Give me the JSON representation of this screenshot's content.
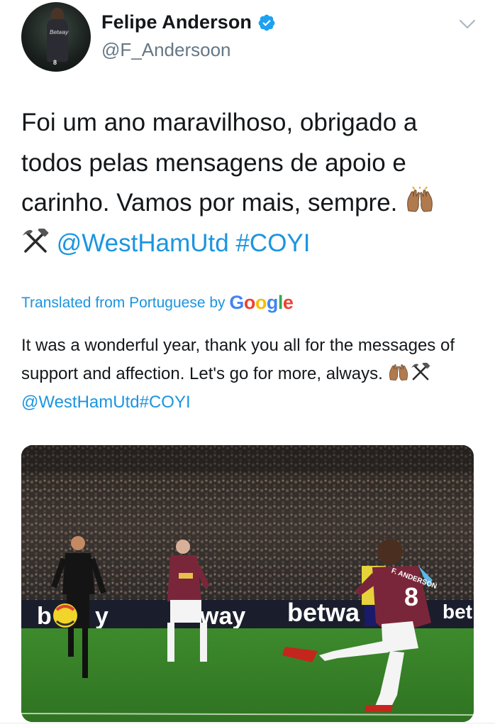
{
  "profile": {
    "display_name": "Felipe Anderson",
    "handle": "@F_Andersoon",
    "verified": true,
    "avatar_icon": "profile-photo",
    "avatar_shirt_text": "Betway",
    "avatar_number": "8"
  },
  "tweet": {
    "line1": "Foi um ano maravilhoso, obrigado a",
    "line2": "todos pelas mensagens de apoio e",
    "line3": "carinho. Vamos por mais, sempre.",
    "mention": "@WestHamUtd",
    "hashtag": "#COYI"
  },
  "translation": {
    "label": "Translated from Portuguese by",
    "provider": [
      "G",
      "o",
      "o",
      "g",
      "l",
      "e"
    ],
    "text_part1": "It was a wonderful year, thank you all for the messages of support and affection. Let's go for more, always.",
    "mention": "@WestHamUtd",
    "hashtag": "#COYI"
  },
  "media": {
    "board_left": "b",
    "board_left2": "y",
    "board_mid": "way",
    "board_right": "betwa",
    "board_far": "bet",
    "player_number": "8",
    "player_name": "F. ANDERSON"
  },
  "colors": {
    "link": "#1b95e0",
    "secondary": "#657786",
    "verified": "#1da1f2",
    "kit_claret": "#7a263a",
    "kit_blue": "#5bb8e8",
    "pitch": "#3f8a2e"
  },
  "icons": [
    "verified-badge-icon",
    "chevron-down-icon",
    "raised-hands-icon",
    "hammer-pick-icon"
  ]
}
